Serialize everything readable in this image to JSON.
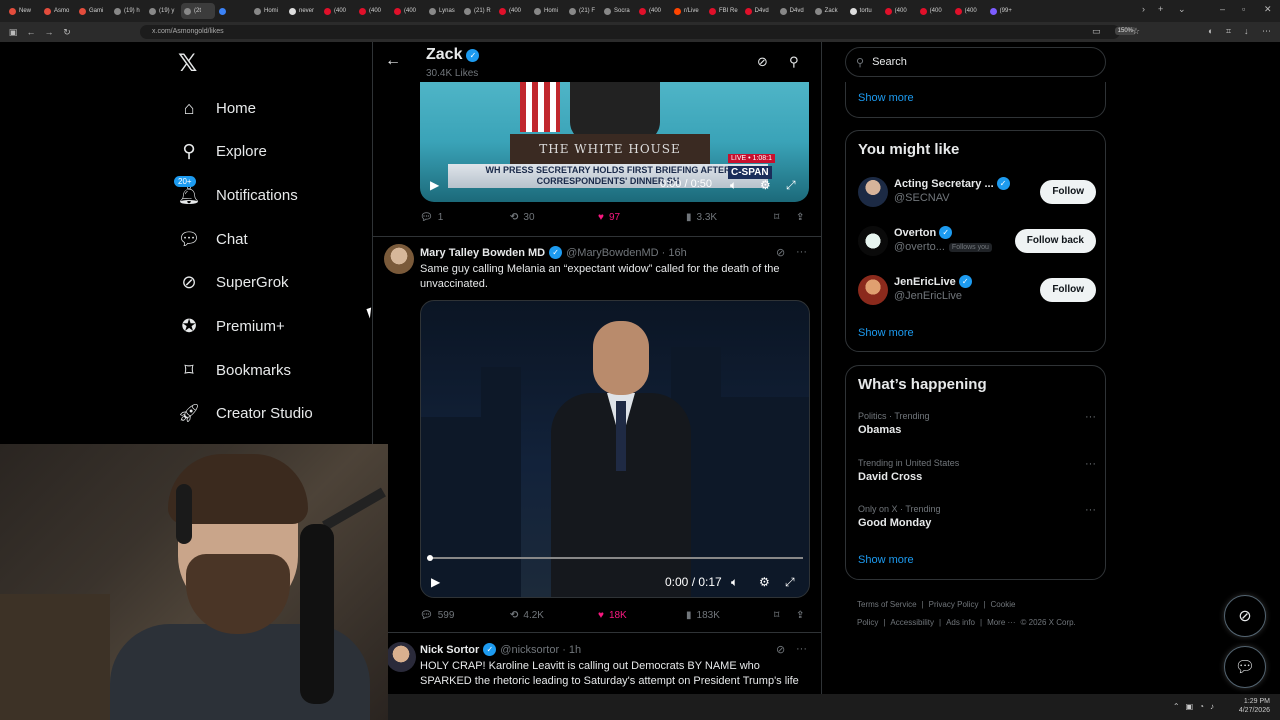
{
  "browser": {
    "tabs": [
      {
        "label": "New",
        "color": "#e34c3c"
      },
      {
        "label": "Asmo",
        "color": "#e34c3c"
      },
      {
        "label": "Gami",
        "color": "#e34c3c"
      },
      {
        "label": "(19) h",
        "color": "#888888"
      },
      {
        "label": "(19) y",
        "color": "#888888"
      },
      {
        "label": "(2t",
        "color": "#888888",
        "active": true
      },
      {
        "label": "",
        "color": "#3b82f6"
      },
      {
        "label": "Homi",
        "color": "#888888"
      },
      {
        "label": "never",
        "color": "#dddddd"
      },
      {
        "label": "(400",
        "color": "#e0102a"
      },
      {
        "label": "(400",
        "color": "#e0102a"
      },
      {
        "label": "(400",
        "color": "#e0102a"
      },
      {
        "label": "Lynas",
        "color": "#888888"
      },
      {
        "label": "(21) R",
        "color": "#888888"
      },
      {
        "label": "(400",
        "color": "#e0102a"
      },
      {
        "label": "Homi",
        "color": "#888888"
      },
      {
        "label": "(21) F",
        "color": "#888888"
      },
      {
        "label": "Socra",
        "color": "#888888"
      },
      {
        "label": "(400",
        "color": "#e0102a"
      },
      {
        "label": "r/Live",
        "color": "#ff4500"
      },
      {
        "label": "FBI Re",
        "color": "#e0102a"
      },
      {
        "label": "D4vd",
        "color": "#e0102a"
      },
      {
        "label": "D4vd",
        "color": "#888888"
      },
      {
        "label": "Zack",
        "color": "#888888"
      },
      {
        "label": "tortu",
        "color": "#dddddd"
      },
      {
        "label": "(400",
        "color": "#e0102a"
      },
      {
        "label": "(400",
        "color": "#e0102a"
      },
      {
        "label": "(400",
        "color": "#e0102a"
      },
      {
        "label": "(99+",
        "color": "#7c5cff"
      }
    ],
    "url": "x.com/Asmongold/likes",
    "zoom": "150%"
  },
  "nav": {
    "items": [
      {
        "label": "Home",
        "icon": "home-icon"
      },
      {
        "label": "Explore",
        "icon": "search-icon"
      },
      {
        "label": "Notifications",
        "icon": "bell-icon",
        "badge": "20+"
      },
      {
        "label": "Chat",
        "icon": "chat-icon"
      },
      {
        "label": "SuperGrok",
        "icon": "grok-icon"
      },
      {
        "label": "Premium+",
        "icon": "premium-icon"
      },
      {
        "label": "Bookmarks",
        "icon": "bookmark-icon"
      },
      {
        "label": "Creator Studio",
        "icon": "rocket-icon"
      }
    ]
  },
  "header": {
    "name": "Zack",
    "likes": "30.4K Likes"
  },
  "tweet1": {
    "podium_text": "THE WHITE HOUSE",
    "chyron": "WH PRESS SECRETARY HOLDS FIRST BRIEFING AFTER CORRESPONDENTS' DINNER SH",
    "live": "LIVE • 1:08:1",
    "network": "C-SPAN",
    "time": "0:00 / 0:50",
    "replies": "1",
    "reposts": "30",
    "likes": "97",
    "views": "3.3K"
  },
  "tweet2": {
    "name": "Mary Talley Bowden MD",
    "handle": "@MaryBowdenMD · 16h",
    "text": "Same guy calling Melania an “expectant widow” called for the death of the unvaccinated.",
    "time": "0:00 / 0:17",
    "replies": "599",
    "reposts": "4.2K",
    "likes": "18K",
    "views": "183K"
  },
  "tweet3": {
    "name": "Nick Sortor",
    "handle": "@nicksortor · 1h",
    "text": "HOLY CRAP! Karoline Leavitt is calling out Democrats BY NAME who SPARKED the rhetoric leading to Saturday's attempt on President Trump's life"
  },
  "sidebar": {
    "search_placeholder": "Search",
    "show_more_top": "Show more",
    "you_might_like": {
      "title": "You might like",
      "accounts": [
        {
          "name": "Acting Secretary ...",
          "handle": "@SECNAV",
          "button": "Follow",
          "follows_you": ""
        },
        {
          "name": "Overton",
          "handle": "@overto...",
          "button": "Follow back",
          "follows_you": "Follows you"
        },
        {
          "name": "JenEricLive",
          "handle": "@JenEricLive",
          "button": "Follow",
          "follows_you": ""
        }
      ],
      "show_more": "Show more"
    },
    "whats_happening": {
      "title": "What’s happening",
      "trends": [
        {
          "context": "Politics · Trending",
          "name": "Obamas"
        },
        {
          "context": "Trending in United States",
          "name": "David Cross"
        },
        {
          "context": "Only on X · Trending",
          "name": "Good Monday"
        }
      ],
      "show_more": "Show more"
    },
    "footer": [
      "Terms of Service",
      "|",
      "Privacy Policy",
      "|",
      "Cookie Policy",
      "|",
      "Accessibility",
      "|",
      "Ads info",
      "|",
      "More ···",
      "© 2026 X Corp."
    ]
  },
  "taskbar": {
    "time": "1:29 PM",
    "date": "4/27/2026"
  },
  "colors": {
    "accent": "#1d9bf0",
    "like": "#f91880",
    "bg": "#000000",
    "border": "#2f3336"
  }
}
